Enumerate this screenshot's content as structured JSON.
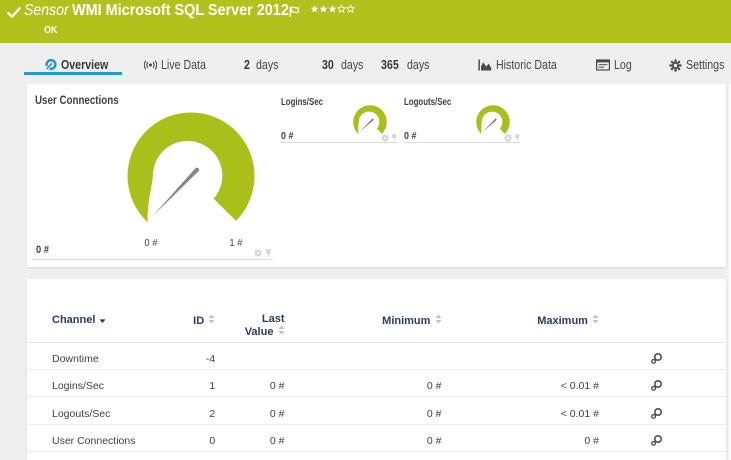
{
  "header": {
    "type_label": "Sensor",
    "title": "WMI Microsoft SQL Server 2012",
    "status": "OK",
    "rating": {
      "filled": 3,
      "total": 5
    }
  },
  "tabs": [
    {
      "label": "Overview",
      "icon": "gauge-icon",
      "active": true
    },
    {
      "label": "Live Data",
      "icon": "live-icon"
    },
    {
      "number": "2",
      "label": "days"
    },
    {
      "number": "30",
      "label": "days"
    },
    {
      "number": "365",
      "label": "days"
    },
    {
      "label": "Historic Data",
      "icon": "area-chart-icon"
    },
    {
      "label": "Log",
      "icon": "log-icon"
    },
    {
      "label": "Settings",
      "icon": "gear-icon"
    }
  ],
  "gauges": {
    "main": {
      "title": "User Connections",
      "value": "0 #",
      "min_label": "0 #",
      "max_label": "1 #"
    },
    "mini": [
      {
        "title": "Logins/Sec",
        "value": "0 #"
      },
      {
        "title": "Logouts/Sec",
        "value": "0 #"
      }
    ]
  },
  "table": {
    "columns": [
      {
        "label": "Channel",
        "sorted": "desc"
      },
      {
        "label": "ID",
        "sortable": true
      },
      {
        "label": "Last Value",
        "sortable": true
      },
      {
        "label": "Minimum",
        "sortable": true
      },
      {
        "label": "Maximum",
        "sortable": true
      }
    ],
    "rows": [
      {
        "channel": "Downtime",
        "id": "-4",
        "last_value": "",
        "minimum": "",
        "maximum": ""
      },
      {
        "channel": "Logins/Sec",
        "id": "1",
        "last_value": "0 #",
        "minimum": "0 #",
        "maximum": "< 0.01 #"
      },
      {
        "channel": "Logouts/Sec",
        "id": "2",
        "last_value": "0 #",
        "minimum": "0 #",
        "maximum": "< 0.01 #"
      },
      {
        "channel": "User Connections",
        "id": "0",
        "last_value": "0 #",
        "minimum": "0 #",
        "maximum": "0 #"
      }
    ]
  },
  "chart_data": [
    {
      "type": "gauge",
      "title": "User Connections",
      "value": 0,
      "min": 0,
      "max": 1,
      "unit": "#"
    },
    {
      "type": "gauge",
      "title": "Logins/Sec",
      "value": 0,
      "unit": "#"
    },
    {
      "type": "gauge",
      "title": "Logouts/Sec",
      "value": 0,
      "unit": "#"
    }
  ]
}
